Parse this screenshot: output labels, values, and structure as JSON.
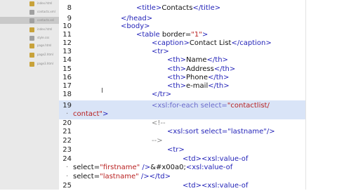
{
  "sidebar": {
    "items": [
      {
        "label": "index.html",
        "icon_color": "#c8a23a",
        "selected": false
      },
      {
        "label": "contacts.xml",
        "icon_color": "#a0a0a0",
        "selected": false
      },
      {
        "label": "contacts.xsl",
        "icon_color": "#a0a0a0",
        "selected": true
      },
      {
        "label": "index.html",
        "icon_color": "#c8a23a",
        "selected": false
      },
      {
        "label": "style.css",
        "icon_color": "#a0a0a0",
        "selected": false
      },
      {
        "label": "page.html",
        "icon_color": "#c8a23a",
        "selected": false
      },
      {
        "label": "page2.html",
        "icon_color": "#c8a23a",
        "selected": false
      },
      {
        "label": "page3.html",
        "icon_color": "#c8a23a",
        "selected": false
      }
    ]
  },
  "editor": {
    "lines": [
      {
        "num": "8",
        "t1": "<title>",
        "t2": "Contacts",
        "t3": "</title>"
      },
      {
        "num": "9",
        "t1": "</head>"
      },
      {
        "num": "10",
        "t1": "<body>"
      },
      {
        "num": "11",
        "t1": "<table ",
        "a1": "border=",
        "v1": "\"1\"",
        "t2": ">"
      },
      {
        "num": "12",
        "t1": "<caption>",
        "t2": "Contact List",
        "t3": "</caption>"
      },
      {
        "num": "13",
        "t1": "<tr>"
      },
      {
        "num": "14",
        "t1": "<th>",
        "t2": "Name",
        "t3": "</th>"
      },
      {
        "num": "15",
        "t1": "<th>",
        "t2": "Address",
        "t3": "</th>"
      },
      {
        "num": "16",
        "t1": "<th>",
        "t2": "Phone",
        "t3": "</th>"
      },
      {
        "num": "17",
        "t1": "<th>",
        "t2": "e-mail",
        "t3": "</th>"
      },
      {
        "num": "18",
        "t1": "</tr>"
      },
      {
        "num": "19",
        "t1": "<xsl:for-each ",
        "a1": "select=",
        "v1": "\"contactlist/"
      },
      {
        "cont": "·",
        "v1": "contact\"",
        "t2": ">"
      },
      {
        "num": "20",
        "t1": "<!--"
      },
      {
        "num": "21",
        "t1": "<xsl:sort select=\"lastname\"/>"
      },
      {
        "num": "22",
        "t1": "-->"
      },
      {
        "num": "23",
        "t1": "<tr>"
      },
      {
        "num": "24",
        "t1": "<td>",
        "t2": "<xsl:value-of"
      },
      {
        "cont": "·",
        "a1": "select=",
        "v1": "\"firstname\"",
        "t2": " />",
        "t3": "&#x00a0;",
        "t4": "<xsl:value-of"
      },
      {
        "cont": "·",
        "a1": "select=",
        "v1": "\"lastname\"",
        "t2": " />",
        "t3": "</td>"
      },
      {
        "num": "25",
        "t1": "<td>",
        "t2": "<xsl:value-of"
      }
    ]
  }
}
